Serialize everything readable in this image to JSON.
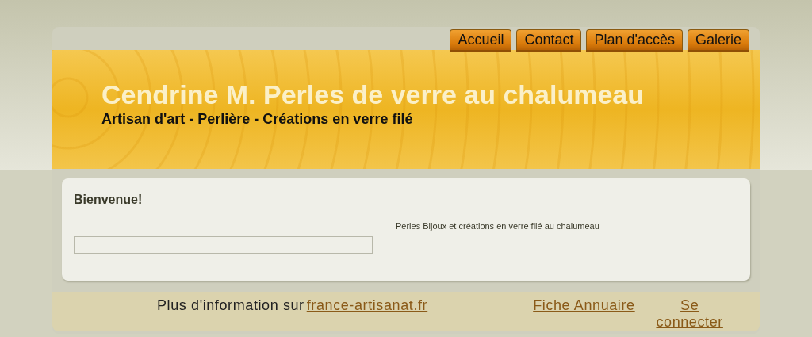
{
  "nav": [
    "Accueil",
    "Contact",
    "Plan d'accès",
    "Galerie"
  ],
  "header": {
    "title": "Cendrine M. Perles de verre au chalumeau",
    "subtitle": "Artisan d'art - Perlière - Créations en verre filé"
  },
  "content": {
    "heading": "Bienvenue!",
    "description": "Perles Bijoux et créations en verre filé au chalumeau"
  },
  "footer": {
    "text": "Plus d'information sur",
    "link": "france-artisanat.fr",
    "links": [
      "Fiche Annuaire",
      "Se connecter"
    ]
  }
}
